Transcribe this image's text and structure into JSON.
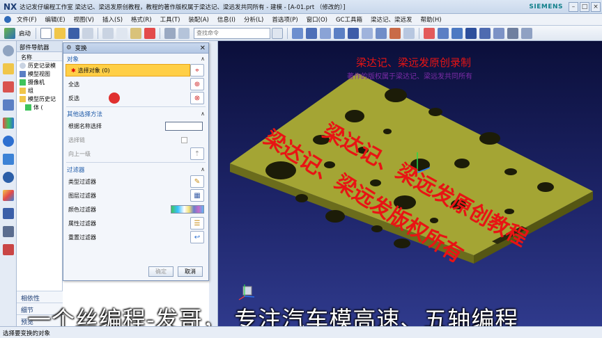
{
  "titlebar": {
    "logo": "NX",
    "title": "达记发仔编程工作室  梁达记、梁远发原创教程，教程的著作版权属于梁达记、梁远发共同所有 - 建模 - [A-01.prt （修改的）]",
    "brand": "SIEMENS",
    "minimize": "–",
    "restore": "□",
    "close": "×"
  },
  "menubar": {
    "items": [
      "文件(F)",
      "编辑(E)",
      "视图(V)",
      "插入(S)",
      "格式(R)",
      "工具(T)",
      "装配(A)",
      "信息(I)",
      "分析(L)",
      "首选项(P)",
      "窗口(O)",
      "GC工具箱",
      "梁达记、梁远发",
      "帮助(H)"
    ]
  },
  "toolbar": {
    "start_label": "启动",
    "command_finder_placeholder": "查找命令"
  },
  "navigator": {
    "title": "部件导航器",
    "column": "名称",
    "rows": [
      "历史记录模",
      "模型视图",
      "摄像机",
      "组",
      "模型历史记",
      "体 ("
    ]
  },
  "dialog": {
    "title": "变换",
    "section_object": "对象",
    "select_object": "选择对象 (0)",
    "select_all": "全选",
    "invert": "反选",
    "section_other": "其他选择方法",
    "by_name": "根据名称选择",
    "selection_chain": "选择链",
    "up_one_level": "向上一级",
    "section_filter": "过滤器",
    "type_filter": "类型过滤器",
    "layer_filter": "图层过滤器",
    "color_filter": "颜色过滤器",
    "attribute_filter": "属性过滤器",
    "reset_filter": "重置过滤器",
    "ok": "确定",
    "cancel": "取消"
  },
  "bottom_panels": [
    "相依性",
    "细节",
    "预览"
  ],
  "status": "选择要变换的对象",
  "watermarks": {
    "line1": "梁达记、梁远发原创录制",
    "line2": "著作的版权属于梁达记、梁远发共同所有",
    "big1": "梁达记、梁远发原创教程",
    "big2": "梁达记、梁远发版权所有"
  },
  "caption": "一个丝编程-发哥， 专注汽车模高速、五轴编程",
  "colors": {
    "part": "#a4a534",
    "part_dark": "#6b6c1c",
    "watermark_red": "#e81414",
    "selection_yellow": "#ffcf46"
  }
}
